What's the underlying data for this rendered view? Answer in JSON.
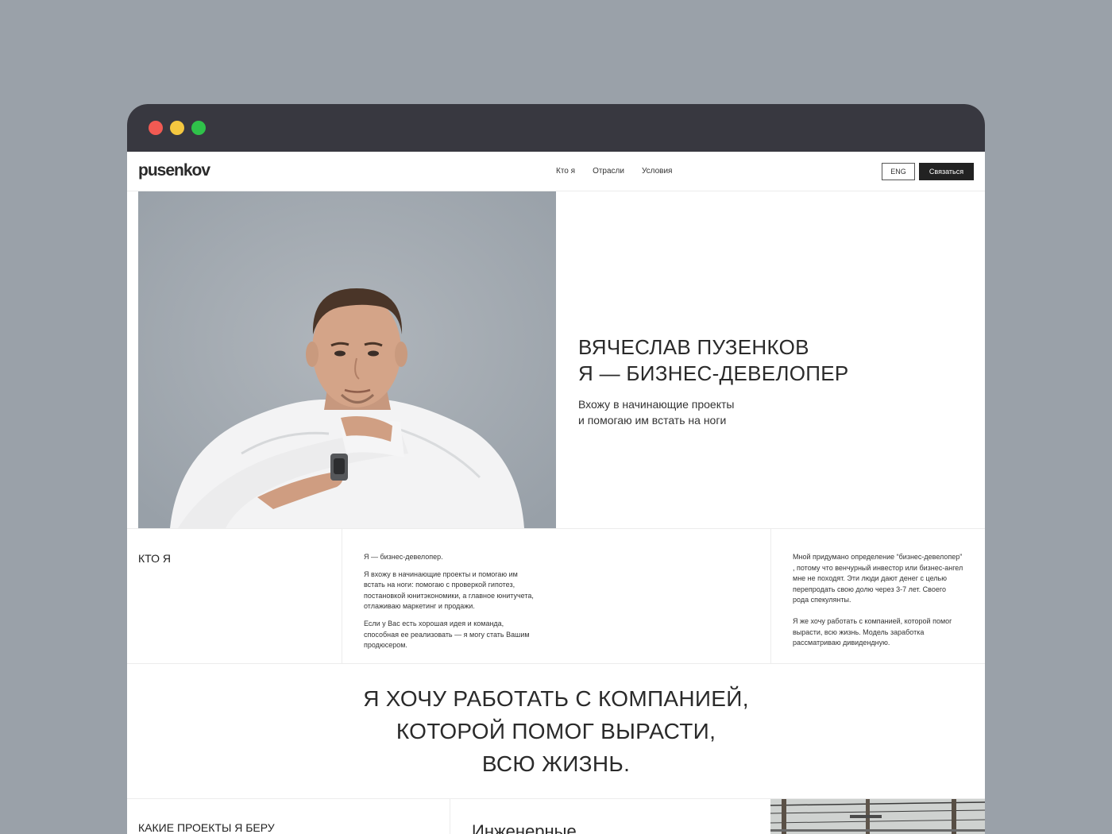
{
  "site": {
    "logo": "pusenkov",
    "nav": [
      {
        "label": "Кто я"
      },
      {
        "label": "Отрасли"
      },
      {
        "label": "Условия"
      }
    ],
    "lang_button": "ENG",
    "contact_button": "Связаться"
  },
  "hero": {
    "title_line1": "ВЯЧЕСЛАВ ПУЗЕНКОВ",
    "title_line2": "Я — БИЗНЕС-ДЕВЕЛОПЕР",
    "subtitle_line1": "Вхожу в начинающие проекты",
    "subtitle_line2": "и помогаю им встать на ноги"
  },
  "who": {
    "heading": "КТО Я",
    "middle": [
      "Я — бизнес-девелопер.",
      "Я вхожу в начинающие проекты и помогаю им встать на ноги: помогаю с проверкой гипотез, постановкой юнитэкономики, а главное юнитучета, отлаживаю маркетинг и продажи.",
      "Если у Вас есть хорошая идея и команда, способная ее реализовать — я могу стать Вашим продюсером."
    ],
    "right": [
      "Мной придумано определение “бизнес-девелопер” , потому что венчурный инвестор или бизнес-ангел мне не походят. Эти люди дают денег с целью перепродать свою долю через 3-7 лет. Своего рода спекулянты.",
      "Я же хочу работать с компанией, которой помог вырасти, всю жизнь. Модель заработка рассматриваю дивидендную."
    ]
  },
  "quote": {
    "line1": "Я ХОЧУ РАБОТАТЬ С КОМПАНИЕЙ,",
    "line2": "КОТОРОЙ ПОМОГ ВЫРАСТИ,",
    "line3": "ВСЮ ЖИЗНЬ."
  },
  "projects": {
    "heading": "КАКИЕ ПРОЕКТЫ Я БЕРУ",
    "first_item": "Инженерные"
  }
}
